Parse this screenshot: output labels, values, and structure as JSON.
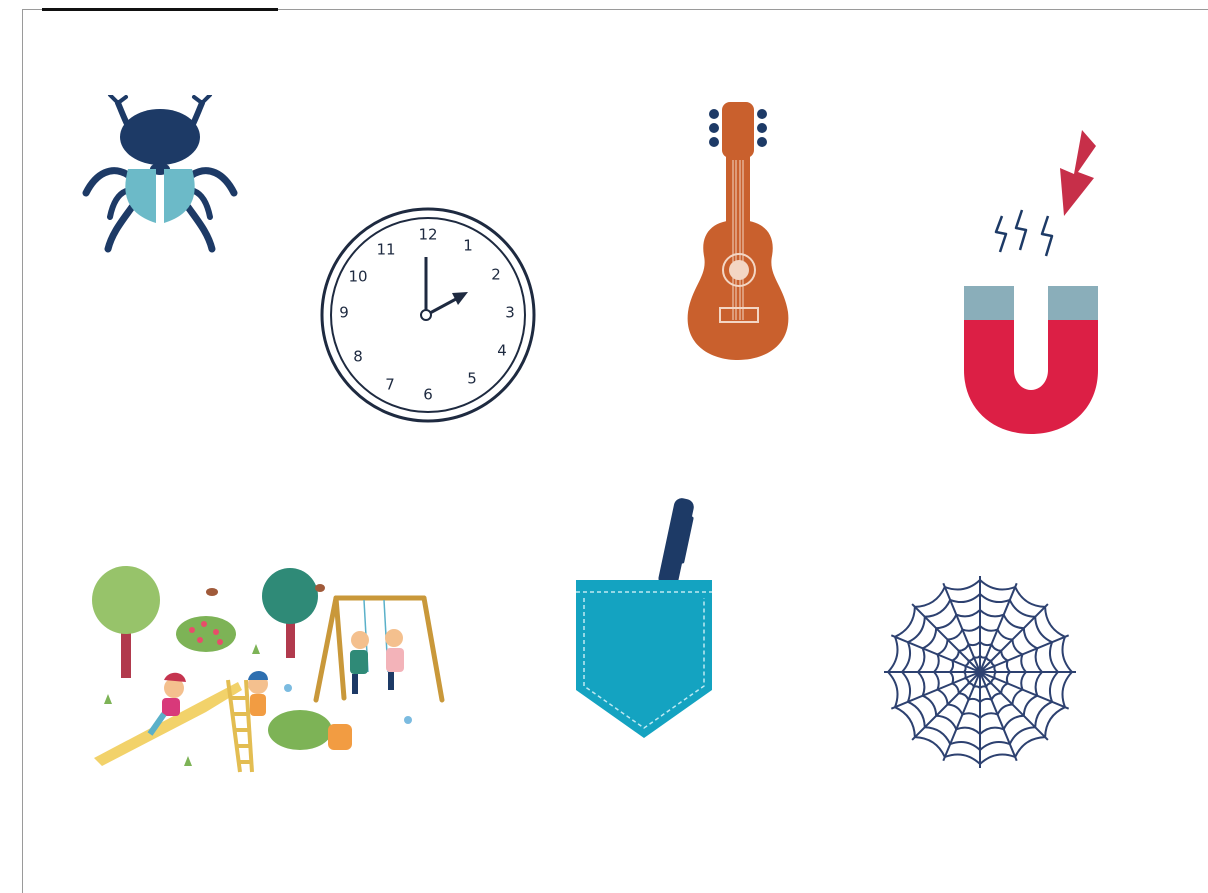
{
  "pictures": [
    {
      "id": "beetle",
      "icon": "beetle-icon"
    },
    {
      "id": "clock",
      "icon": "clock-icon",
      "clock": {
        "numbers": [
          "12",
          "1",
          "2",
          "3",
          "4",
          "5",
          "6",
          "7",
          "8",
          "9",
          "10",
          "11"
        ]
      }
    },
    {
      "id": "guitar",
      "icon": "guitar-icon"
    },
    {
      "id": "magnet",
      "icon": "magnet-icon"
    },
    {
      "id": "playground",
      "icon": "playground-icon"
    },
    {
      "id": "pocket",
      "icon": "pocket-with-pen-icon"
    },
    {
      "id": "spider-web",
      "icon": "spider-web-icon"
    }
  ],
  "colors": {
    "navy": "#1d3a66",
    "teal_light": "#6cbac8",
    "guitar_orange": "#c9602d",
    "magnet_red": "#dc1f45",
    "magnet_tip": "#8aaeba",
    "arrow_red": "#c72f49",
    "pocket_teal": "#14a3c1",
    "web_navy": "#2d4170"
  }
}
